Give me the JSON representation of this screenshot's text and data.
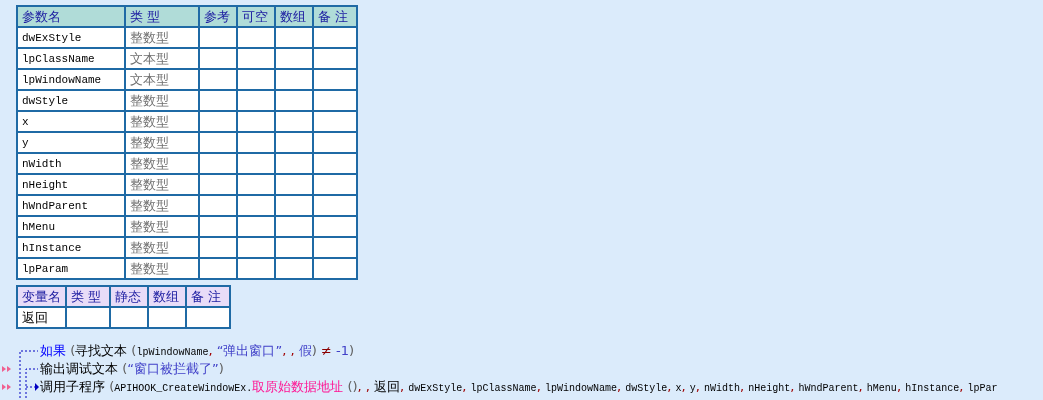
{
  "params_table": {
    "columns": [
      "参数名",
      "类 型",
      "参考",
      "可空",
      "数组",
      "备 注"
    ],
    "rows": [
      {
        "name": "dwExStyle",
        "type": "整数型"
      },
      {
        "name": "lpClassName",
        "type": "文本型"
      },
      {
        "name": "lpWindowName",
        "type": "文本型"
      },
      {
        "name": "dwStyle",
        "type": "整数型"
      },
      {
        "name": "x",
        "type": "整数型"
      },
      {
        "name": "y",
        "type": "整数型"
      },
      {
        "name": "nWidth",
        "type": "整数型"
      },
      {
        "name": "nHeight",
        "type": "整数型"
      },
      {
        "name": "hWndParent",
        "type": "整数型"
      },
      {
        "name": "hMenu",
        "type": "整数型"
      },
      {
        "name": "hInstance",
        "type": "整数型"
      },
      {
        "name": "lpParam",
        "type": "整数型"
      }
    ]
  },
  "locals_table": {
    "columns": [
      "变量名",
      "类 型",
      "静态",
      "数组",
      "备 注"
    ],
    "rows": [
      {
        "name": "返回"
      }
    ]
  },
  "code_lines": [
    {
      "breakpoint": false,
      "tokens": [
        {
          "kind": "keyword",
          "text": "如果"
        },
        {
          "kind": "paren",
          "text": " ("
        },
        {
          "kind": "command",
          "text": "寻找文本"
        },
        {
          "kind": "paren",
          "text": " ("
        },
        {
          "kind": "ident",
          "text": "lpWindowName"
        },
        {
          "kind": "comma",
          "text": ", "
        },
        {
          "kind": "string",
          "text": "“弹出窗口”"
        },
        {
          "kind": "comma",
          "text": ", , "
        },
        {
          "kind": "constant",
          "text": "假"
        },
        {
          "kind": "paren",
          "text": ")"
        },
        {
          "kind": "operator",
          "text": " ≠ "
        },
        {
          "kind": "constant",
          "text": "-1"
        },
        {
          "kind": "paren",
          "text": ")"
        }
      ]
    },
    {
      "breakpoint": true,
      "tokens": [
        {
          "kind": "command",
          "text": "输出调试文本"
        },
        {
          "kind": "paren",
          "text": " ("
        },
        {
          "kind": "string",
          "text": "“窗口被拦截了”"
        },
        {
          "kind": "paren",
          "text": ")"
        }
      ]
    },
    {
      "breakpoint": true,
      "tokens": [
        {
          "kind": "command",
          "text": "调用子程序"
        },
        {
          "kind": "paren",
          "text": " ("
        },
        {
          "kind": "ident",
          "text": "APIHOOK_CreateWindowEx."
        },
        {
          "kind": "method",
          "text": "取原始数据地址"
        },
        {
          "kind": "paren",
          "text": " ()"
        },
        {
          "kind": "comma",
          "text": ", , "
        },
        {
          "kind": "command",
          "text": "返回"
        },
        {
          "kind": "comma",
          "text": ", "
        },
        {
          "kind": "ident",
          "text": "dwExStyle"
        },
        {
          "kind": "comma",
          "text": ", "
        },
        {
          "kind": "ident",
          "text": "lpClassName"
        },
        {
          "kind": "comma",
          "text": ", "
        },
        {
          "kind": "ident",
          "text": "lpWindowName"
        },
        {
          "kind": "comma",
          "text": ", "
        },
        {
          "kind": "ident",
          "text": "dwStyle"
        },
        {
          "kind": "comma",
          "text": ", "
        },
        {
          "kind": "ident",
          "text": "x"
        },
        {
          "kind": "comma",
          "text": ", "
        },
        {
          "kind": "ident",
          "text": "y"
        },
        {
          "kind": "comma",
          "text": ", "
        },
        {
          "kind": "ident",
          "text": "nWidth"
        },
        {
          "kind": "comma",
          "text": ", "
        },
        {
          "kind": "ident",
          "text": "nHeight"
        },
        {
          "kind": "comma",
          "text": ", "
        },
        {
          "kind": "ident",
          "text": "hWndParent"
        },
        {
          "kind": "comma",
          "text": ", "
        },
        {
          "kind": "ident",
          "text": "hMenu"
        },
        {
          "kind": "comma",
          "text": ", "
        },
        {
          "kind": "ident",
          "text": "hInstance"
        },
        {
          "kind": "comma",
          "text": ", "
        },
        {
          "kind": "ident",
          "text": "lpPar"
        }
      ]
    }
  ]
}
